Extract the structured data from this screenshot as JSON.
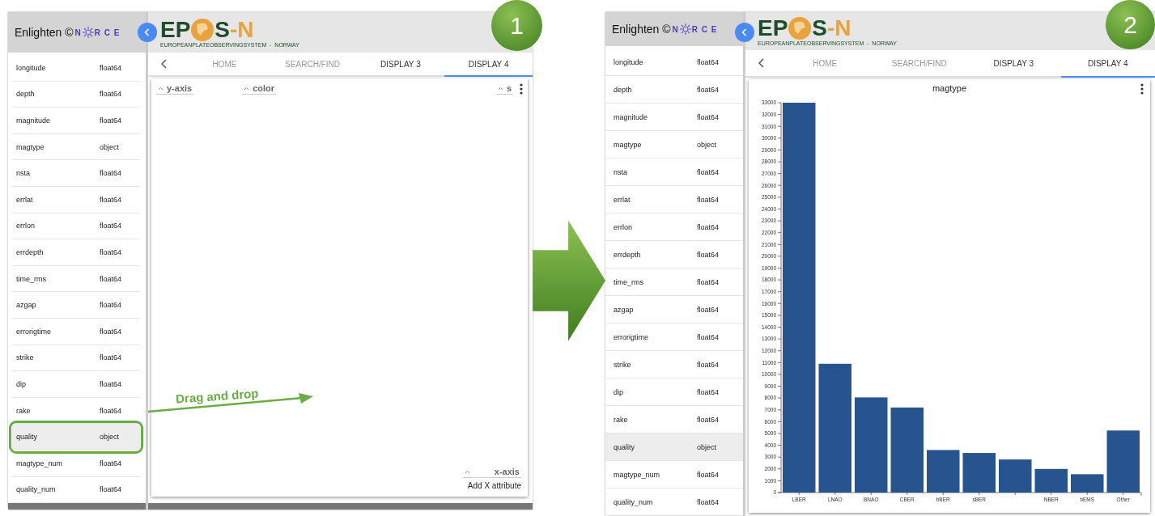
{
  "panels": [
    {
      "badge": "1",
      "kind": "shelves",
      "sidebar_header": {
        "brand": "Enlighten ©",
        "norce_before": "N",
        "norce_after": "R C E"
      },
      "logo": {
        "before": "EP",
        "after": "S",
        "suffix": "-N",
        "tagline": "EUROPEANPLATEOBSERVINGSYSTEM  -  NORWAY"
      },
      "fields": [
        {
          "name": "longitude",
          "type": "float64",
          "selected": false,
          "outlined": false
        },
        {
          "name": "depth",
          "type": "float64",
          "selected": false,
          "outlined": false
        },
        {
          "name": "magnitude",
          "type": "float64",
          "selected": false,
          "outlined": false
        },
        {
          "name": "magtype",
          "type": "object",
          "selected": false,
          "outlined": false
        },
        {
          "name": "nsta",
          "type": "float64",
          "selected": false,
          "outlined": false
        },
        {
          "name": "errlat",
          "type": "float64",
          "selected": false,
          "outlined": false
        },
        {
          "name": "errlon",
          "type": "float64",
          "selected": false,
          "outlined": false
        },
        {
          "name": "errdepth",
          "type": "float64",
          "selected": false,
          "outlined": false
        },
        {
          "name": "time_rms",
          "type": "float64",
          "selected": false,
          "outlined": false
        },
        {
          "name": "azgap",
          "type": "float64",
          "selected": false,
          "outlined": false
        },
        {
          "name": "errorigtime",
          "type": "float64",
          "selected": false,
          "outlined": false
        },
        {
          "name": "strike",
          "type": "float64",
          "selected": false,
          "outlined": false
        },
        {
          "name": "dip",
          "type": "float64",
          "selected": false,
          "outlined": false
        },
        {
          "name": "rake",
          "type": "float64",
          "selected": false,
          "outlined": false
        },
        {
          "name": "quality",
          "type": "object",
          "selected": true,
          "outlined": true
        },
        {
          "name": "magtype_num",
          "type": "float64",
          "selected": false,
          "outlined": false
        },
        {
          "name": "quality_num",
          "type": "float64",
          "selected": false,
          "outlined": false
        }
      ],
      "tabs": [
        {
          "label": "HOME",
          "selected": false,
          "dimmed": true
        },
        {
          "label": "SEARCH/FIND",
          "selected": false,
          "dimmed": true
        },
        {
          "label": "DISPLAY 3",
          "selected": false,
          "dimmed": false
        },
        {
          "label": "DISPLAY 4",
          "selected": true,
          "dimmed": false
        }
      ],
      "shelves": [
        "y-axis",
        "color",
        "s"
      ],
      "x_shelf": {
        "label": "x-axis",
        "hint": "Add X attribute"
      },
      "drag_label": "Drag and drop"
    },
    {
      "badge": "2",
      "kind": "chart",
      "sidebar_header": {
        "brand": "Enlighten ©",
        "norce_before": "N",
        "norce_after": "R C E"
      },
      "logo": {
        "before": "EP",
        "after": "S",
        "suffix": "-N",
        "tagline": "EUROPEANPLATEOBSERVINGSYSTEM  -  NORWAY"
      },
      "fields": [
        {
          "name": "longitude",
          "type": "float64",
          "selected": false
        },
        {
          "name": "depth",
          "type": "float64",
          "selected": false
        },
        {
          "name": "magnitude",
          "type": "float64",
          "selected": false
        },
        {
          "name": "magtype",
          "type": "object",
          "selected": false
        },
        {
          "name": "nsta",
          "type": "float64",
          "selected": false
        },
        {
          "name": "errlat",
          "type": "float64",
          "selected": false
        },
        {
          "name": "errlon",
          "type": "float64",
          "selected": false
        },
        {
          "name": "errdepth",
          "type": "float64",
          "selected": false
        },
        {
          "name": "time_rms",
          "type": "float64",
          "selected": false
        },
        {
          "name": "azgap",
          "type": "float64",
          "selected": false
        },
        {
          "name": "errorigtime",
          "type": "float64",
          "selected": false
        },
        {
          "name": "strike",
          "type": "float64",
          "selected": false
        },
        {
          "name": "dip",
          "type": "float64",
          "selected": false
        },
        {
          "name": "rake",
          "type": "float64",
          "selected": false
        },
        {
          "name": "quality",
          "type": "object",
          "selected": true
        },
        {
          "name": "magtype_num",
          "type": "float64",
          "selected": false
        },
        {
          "name": "quality_num",
          "type": "float64",
          "selected": false
        }
      ],
      "tabs": [
        {
          "label": "HOME",
          "selected": false,
          "dimmed": true
        },
        {
          "label": "SEARCH/FIND",
          "selected": false,
          "dimmed": true
        },
        {
          "label": "DISPLAY 3",
          "selected": false,
          "dimmed": false
        },
        {
          "label": "DISPLAY 4",
          "selected": true,
          "dimmed": false
        }
      ],
      "chart_data": {
        "type": "bar",
        "title": "magtype",
        "categories": [
          "LBER",
          "LNAO",
          "BNAO",
          "CBER",
          "bBER",
          "sBER",
          null,
          "NBER",
          "bEMS",
          "Other"
        ],
        "values": [
          33000,
          10900,
          8050,
          7200,
          3600,
          3350,
          2800,
          2000,
          1550,
          5250
        ],
        "ylim": [
          0,
          33000
        ],
        "yticks": [
          0,
          1000,
          2000,
          3000,
          4000,
          5000,
          6000,
          7000,
          8000,
          9000,
          10000,
          11000,
          12000,
          13000,
          14000,
          15000,
          16000,
          17000,
          18000,
          19000,
          20000,
          21000,
          22000,
          23000,
          24000,
          25000,
          26000,
          27000,
          28000,
          29000,
          30000,
          31000,
          32000,
          33000
        ]
      }
    }
  ]
}
